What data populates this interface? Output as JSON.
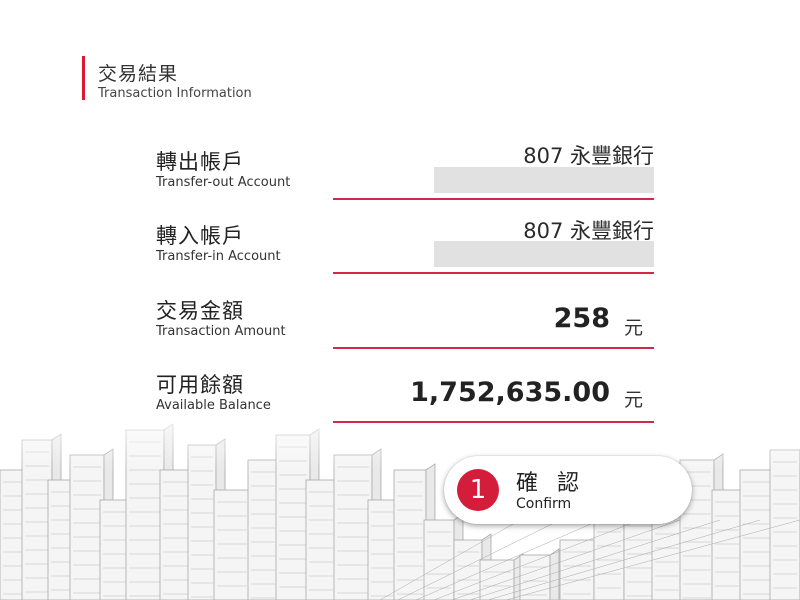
{
  "header": {
    "title_zh": "交易結果",
    "title_en": "Transaction Information",
    "accent_color": "#d71c34"
  },
  "fields": {
    "transfer_out": {
      "label_zh": "轉出帳戶",
      "label_en": "Transfer-out Account",
      "bank": "807 永豐銀行"
    },
    "transfer_in": {
      "label_zh": "轉入帳戶",
      "label_en": "Transfer-in Account",
      "bank": "807 永豐銀行"
    },
    "amount": {
      "label_zh": "交易金額",
      "label_en": "Transaction Amount",
      "value": "258",
      "unit": "元"
    },
    "balance": {
      "label_zh": "可用餘額",
      "label_en": "Available Balance",
      "value": "1,752,635.00",
      "unit": "元"
    }
  },
  "confirm": {
    "step_number": "1",
    "label_zh": "確 認",
    "label_en": "Confirm"
  },
  "background": {
    "icon": "city-skyline-illustration"
  }
}
